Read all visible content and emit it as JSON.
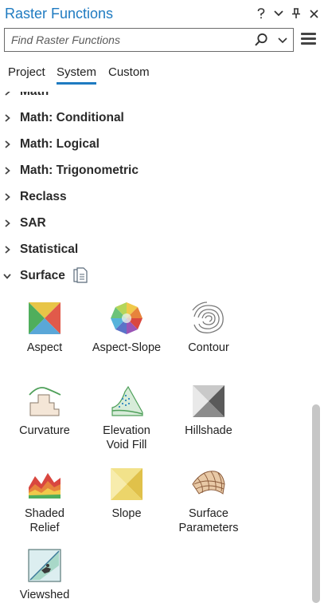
{
  "window": {
    "title": "Raster Functions",
    "help_label": "?",
    "options_label": "⌄",
    "pin_label": "⊥",
    "close_label": "✕"
  },
  "search": {
    "placeholder": "Find Raster Functions",
    "value": ""
  },
  "tabs": [
    {
      "label": "Project",
      "active": false
    },
    {
      "label": "System",
      "active": true
    },
    {
      "label": "Custom",
      "active": false
    }
  ],
  "categories": [
    {
      "label": "Math",
      "expanded": false,
      "partial": true
    },
    {
      "label": "Math: Conditional",
      "expanded": false
    },
    {
      "label": "Math: Logical",
      "expanded": false
    },
    {
      "label": "Math: Trigonometric",
      "expanded": false
    },
    {
      "label": "Reclass",
      "expanded": false
    },
    {
      "label": "SAR",
      "expanded": false
    },
    {
      "label": "Statistical",
      "expanded": false
    },
    {
      "label": "Surface",
      "expanded": true
    }
  ],
  "surface_functions": [
    {
      "label": "Aspect",
      "icon": "aspect-icon"
    },
    {
      "label": "Aspect-Slope",
      "icon": "aspect-slope-icon"
    },
    {
      "label": "Contour",
      "icon": "contour-icon"
    },
    {
      "label": "Curvature",
      "icon": "curvature-icon"
    },
    {
      "label": "Elevation\nVoid Fill",
      "line1": "Elevation",
      "line2": "Void Fill",
      "icon": "elevation-void-fill-icon"
    },
    {
      "label": "Hillshade",
      "icon": "hillshade-icon"
    },
    {
      "label": "Shaded\nRelief",
      "line1": "Shaded",
      "line2": "Relief",
      "icon": "shaded-relief-icon"
    },
    {
      "label": "Slope",
      "icon": "slope-icon"
    },
    {
      "label": "Surface\nParameters",
      "line1": "Surface",
      "line2": "Parameters",
      "icon": "surface-parameters-icon"
    },
    {
      "label": "Viewshed",
      "icon": "viewshed-icon"
    }
  ],
  "colors": {
    "accent": "#1f7bc1"
  }
}
